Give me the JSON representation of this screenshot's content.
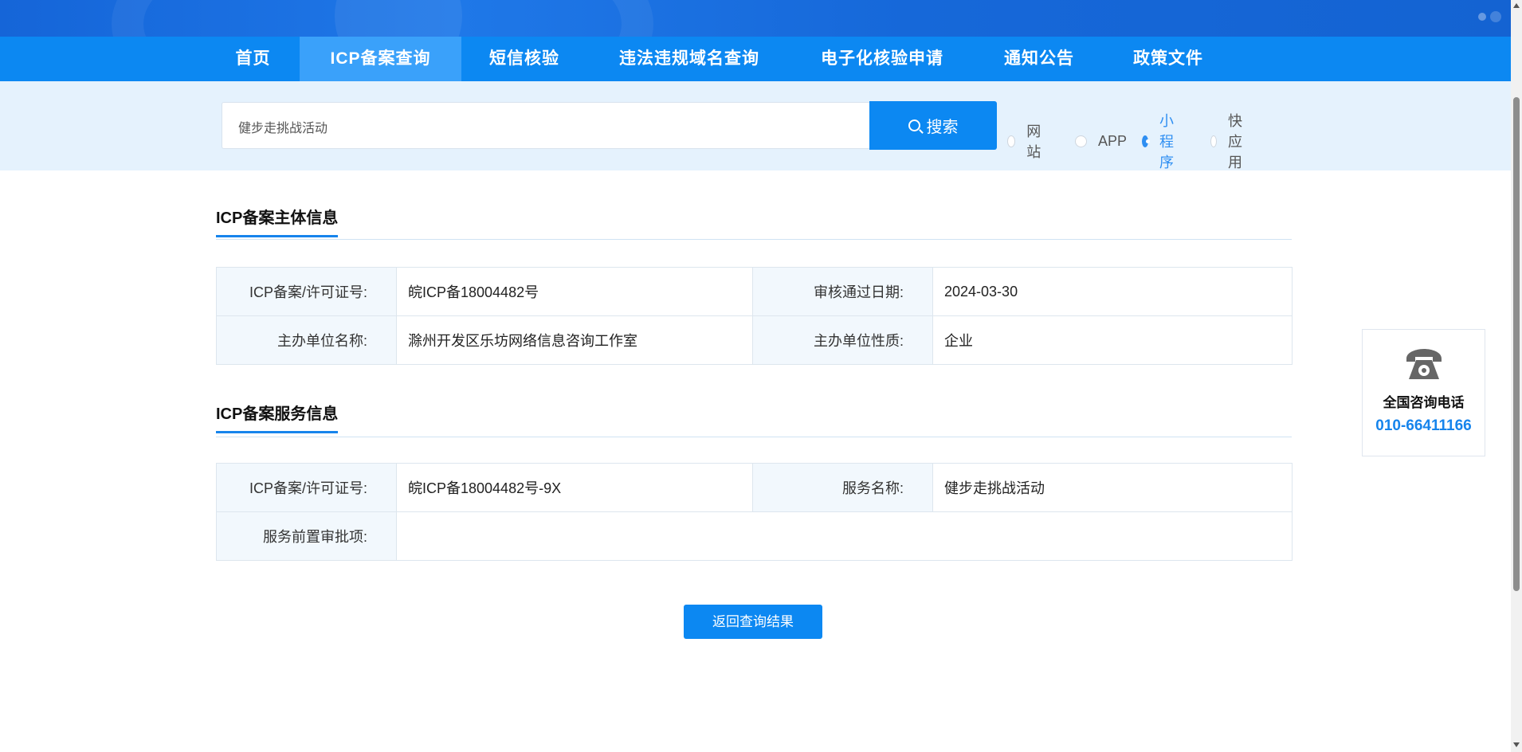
{
  "nav": {
    "items": [
      {
        "label": "首页"
      },
      {
        "label": "ICP备案查询"
      },
      {
        "label": "短信核验"
      },
      {
        "label": "违法违规域名查询"
      },
      {
        "label": "电子化核验申请"
      },
      {
        "label": "通知公告"
      },
      {
        "label": "政策文件"
      }
    ],
    "active_index": 1
  },
  "search": {
    "value": "健步走挑战活动",
    "button_label": "搜索",
    "types": [
      {
        "label": "网站",
        "checked": false
      },
      {
        "label": "APP",
        "checked": false
      },
      {
        "label": "小程序",
        "checked": true
      },
      {
        "label": "快应用",
        "checked": false
      }
    ]
  },
  "entity": {
    "title": "ICP备案主体信息",
    "rows": [
      {
        "l1": "ICP备案/许可证号:",
        "v1": "皖ICP备18004482号",
        "l2": "审核通过日期:",
        "v2": "2024-03-30"
      },
      {
        "l1": "主办单位名称:",
        "v1": "滁州开发区乐坊网络信息咨询工作室",
        "l2": "主办单位性质:",
        "v2": "企业"
      }
    ]
  },
  "service": {
    "title": "ICP备案服务信息",
    "license_label": "ICP备案/许可证号:",
    "license_value": "皖ICP备18004482号-9X",
    "name_label": "服务名称:",
    "name_value": "健步走挑战活动",
    "approval_label": "服务前置审批项:",
    "approval_value": ""
  },
  "back_button": "返回查询结果",
  "consult": {
    "title": "全国咨询电话",
    "number": "010-66411166"
  },
  "colors": {
    "primary": "#0c88f2",
    "nav_active": "#3aa1fa",
    "search_band": "#e5f2fd",
    "label_bg": "#f2f8fd"
  }
}
